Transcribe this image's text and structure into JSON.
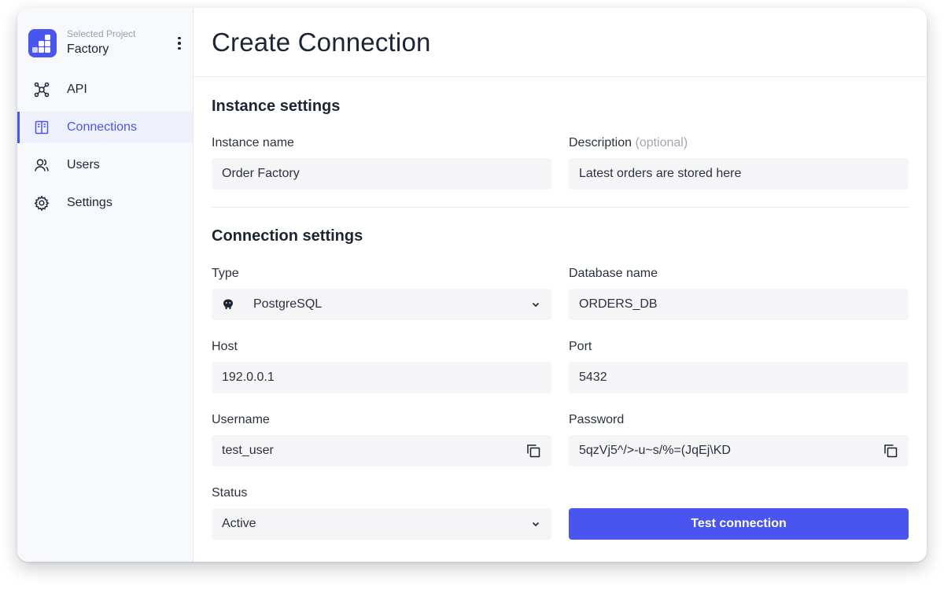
{
  "project": {
    "caption": "Selected Project",
    "name": "Factory"
  },
  "nav": {
    "items": [
      {
        "label": "API",
        "icon": "api-network-icon",
        "active": false
      },
      {
        "label": "Connections",
        "icon": "database-columns-icon",
        "active": true
      },
      {
        "label": "Users",
        "icon": "users-icon",
        "active": false
      },
      {
        "label": "Settings",
        "icon": "gear-icon",
        "active": false
      }
    ]
  },
  "page": {
    "title": "Create Connection"
  },
  "instance": {
    "section_title": "Instance settings",
    "name_label": "Instance name",
    "name_value": "Order Factory",
    "description_label": "Description",
    "description_optional": "(optional)",
    "description_value": "Latest orders are stored here"
  },
  "connection": {
    "section_title": "Connection settings",
    "type_label": "Type",
    "type_value": "PostgreSQL",
    "type_icon": "postgresql-elephant-icon",
    "database_label": "Database name",
    "database_value": "ORDERS_DB",
    "host_label": "Host",
    "host_value": "192.0.0.1",
    "port_label": "Port",
    "port_value": "5432",
    "username_label": "Username",
    "username_value": "test_user",
    "password_label": "Password",
    "password_value": "5qzVj5^/>-u~s/%=(JqEj\\KD",
    "status_label": "Status",
    "status_value": "Active",
    "test_button": "Test connection"
  },
  "colors": {
    "accent": "#4a55ef",
    "sidebar_bg": "#f7f8fb",
    "field_bg": "#f5f5f7"
  }
}
